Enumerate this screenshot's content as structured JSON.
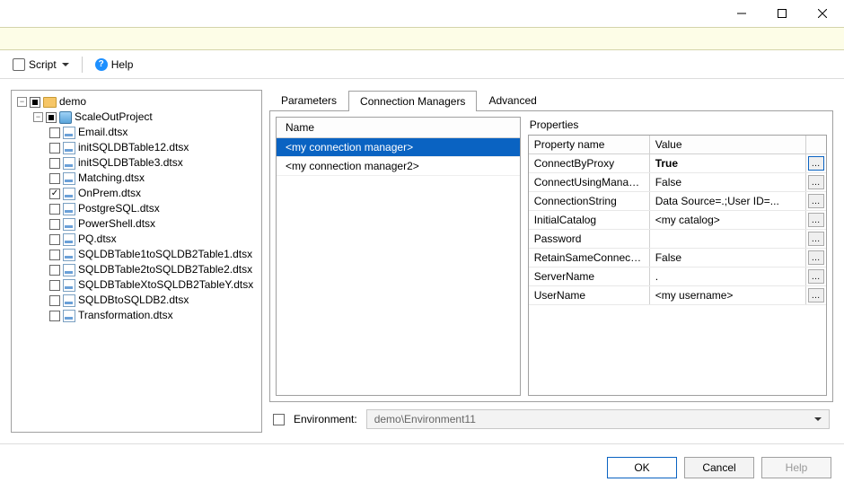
{
  "toolbar": {
    "script": "Script",
    "help": "Help"
  },
  "tree": {
    "root": "demo",
    "project": "ScaleOutProject",
    "packages": [
      {
        "name": "Email.dtsx",
        "checked": false
      },
      {
        "name": "initSQLDBTable12.dtsx",
        "checked": false
      },
      {
        "name": "initSQLDBTable3.dtsx",
        "checked": false
      },
      {
        "name": "Matching.dtsx",
        "checked": false
      },
      {
        "name": "OnPrem.dtsx",
        "checked": true
      },
      {
        "name": "PostgreSQL.dtsx",
        "checked": false
      },
      {
        "name": "PowerShell.dtsx",
        "checked": false
      },
      {
        "name": "PQ.dtsx",
        "checked": false
      },
      {
        "name": "SQLDBTable1toSQLDB2Table1.dtsx",
        "checked": false
      },
      {
        "name": "SQLDBTable2toSQLDB2Table2.dtsx",
        "checked": false
      },
      {
        "name": "SQLDBTableXtoSQLDB2TableY.dtsx",
        "checked": false
      },
      {
        "name": "SQLDBtoSQLDB2.dtsx",
        "checked": false
      },
      {
        "name": "Transformation.dtsx",
        "checked": false
      }
    ]
  },
  "tabs": {
    "parameters": "Parameters",
    "connmgrs": "Connection Managers",
    "advanced": "Advanced"
  },
  "connmgrs": {
    "header": "Name",
    "items": [
      {
        "name": "<my connection manager>",
        "selected": true
      },
      {
        "name": "<my connection manager2>",
        "selected": false
      }
    ]
  },
  "props": {
    "label": "Properties",
    "head_name": "Property name",
    "head_value": "Value",
    "rows": [
      {
        "name": "ConnectByProxy",
        "value": "True",
        "bold": true,
        "ellipsis": true,
        "hot": true
      },
      {
        "name": "ConnectUsingManagedIdentity",
        "value": "False",
        "ellipsis": true
      },
      {
        "name": "ConnectionString",
        "value": "Data Source=.;User ID=...",
        "ellipsis": true
      },
      {
        "name": "InitialCatalog",
        "value": "<my catalog>",
        "ellipsis": true
      },
      {
        "name": "Password",
        "value": "",
        "ellipsis": true
      },
      {
        "name": "RetainSameConnection",
        "value": "False",
        "ellipsis": true
      },
      {
        "name": "ServerName",
        "value": ".",
        "ellipsis": true
      },
      {
        "name": "UserName",
        "value": "<my username>",
        "ellipsis": true
      }
    ]
  },
  "env": {
    "label": "Environment:",
    "value": "demo\\Environment11"
  },
  "footer": {
    "ok": "OK",
    "cancel": "Cancel",
    "help": "Help"
  }
}
